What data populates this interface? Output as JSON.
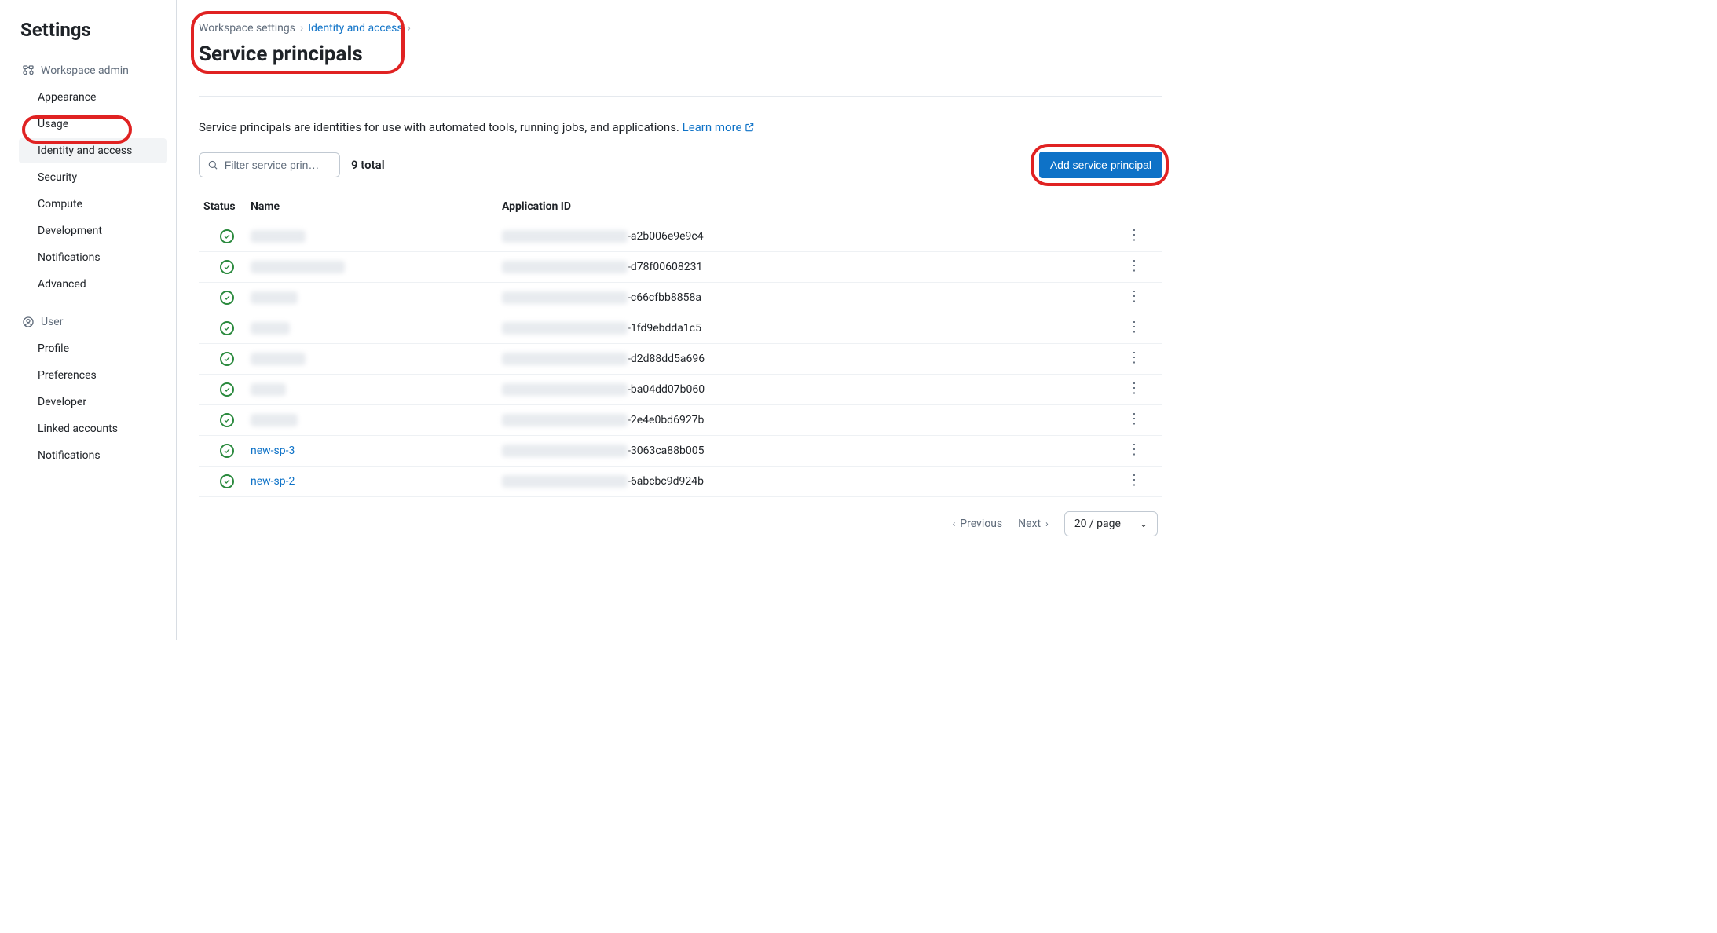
{
  "sidebar": {
    "title": "Settings",
    "sections": [
      {
        "header": "Workspace admin",
        "icon": "workspace-admin-icon",
        "items": [
          "Appearance",
          "Usage",
          "Identity and access",
          "Security",
          "Compute",
          "Development",
          "Notifications",
          "Advanced"
        ],
        "active_index": 2
      },
      {
        "header": "User",
        "icon": "user-icon",
        "items": [
          "Profile",
          "Preferences",
          "Developer",
          "Linked accounts",
          "Notifications"
        ]
      }
    ]
  },
  "breadcrumbs": {
    "items": [
      "Workspace settings",
      "Identity and access"
    ],
    "link_start_index": 1
  },
  "page": {
    "title": "Service principals",
    "description_prefix": "Service principals are identities for use with automated tools, running jobs, and applications. ",
    "learn_more": "Learn more"
  },
  "toolbar": {
    "filter_placeholder": "Filter service prin…",
    "total_label": "9 total",
    "add_button": "Add service principal"
  },
  "table": {
    "columns": [
      "Status",
      "Name",
      "Application ID"
    ],
    "rows": [
      {
        "status": "active",
        "name": null,
        "name_link": false,
        "appid_suffix": "-a2b006e9e9c4"
      },
      {
        "status": "active",
        "name": null,
        "name_link": false,
        "appid_suffix": "-d78f00608231"
      },
      {
        "status": "active",
        "name": null,
        "name_link": false,
        "appid_suffix": "-c66cfbb8858a"
      },
      {
        "status": "active",
        "name": null,
        "name_link": false,
        "appid_suffix": "-1fd9ebdda1c5"
      },
      {
        "status": "active",
        "name": null,
        "name_link": false,
        "appid_suffix": "-d2d88dd5a696"
      },
      {
        "status": "active",
        "name": null,
        "name_link": false,
        "appid_suffix": "-ba04dd07b060"
      },
      {
        "status": "active",
        "name": null,
        "name_link": false,
        "appid_suffix": "-2e4e0bd6927b"
      },
      {
        "status": "active",
        "name": "new-sp-3",
        "name_link": true,
        "appid_suffix": "-3063ca88b005"
      },
      {
        "status": "active",
        "name": "new-sp-2",
        "name_link": true,
        "appid_suffix": "-6abcbc9d924b"
      }
    ]
  },
  "pagination": {
    "previous": "Previous",
    "next": "Next",
    "page_size": "20 / page"
  }
}
